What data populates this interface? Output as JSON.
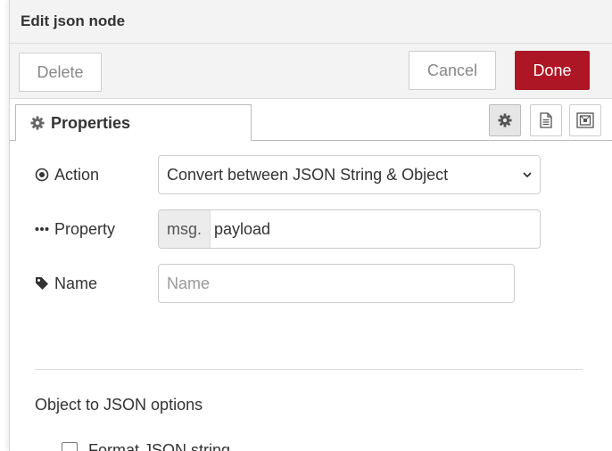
{
  "header": {
    "title": "Edit json node"
  },
  "toolbar": {
    "delete_label": "Delete",
    "cancel_label": "Cancel",
    "done_label": "Done"
  },
  "tabs": [
    {
      "label": "Properties",
      "icon": "gear-icon"
    }
  ],
  "tab_tools": [
    "gear-icon",
    "document-icon",
    "frame-icon"
  ],
  "form": {
    "action": {
      "label": "Action",
      "icon": "target-icon",
      "value": "Convert between JSON String & Object"
    },
    "property": {
      "label": "Property",
      "icon": "ellipsis-icon",
      "type": "msg.",
      "value": "payload"
    },
    "name": {
      "label": "Name",
      "icon": "tag-icon",
      "value": "",
      "placeholder": "Name"
    }
  },
  "options": {
    "title": "Object to JSON options",
    "format_label": "Format JSON string",
    "format_checked": false
  },
  "colors": {
    "done": "#ad1625",
    "header_bg": "#f3f3f3"
  }
}
